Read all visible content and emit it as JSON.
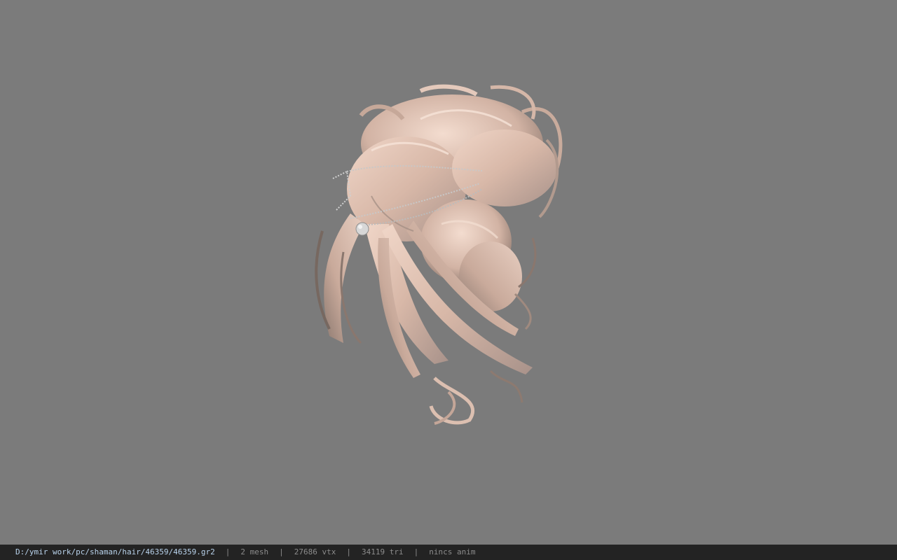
{
  "viewer": {
    "background": "#7b7b7b",
    "model_name": "hair-model",
    "hair_light_color": "#e6cbbd",
    "hair_dark_color": "#8f7a70",
    "accessory_color": "#c8c8c8"
  },
  "statusbar": {
    "file_path": "D:/ymir work/pc/shaman/hair/46359/46359.gr2",
    "separator": "|",
    "mesh_count": "2 mesh",
    "vertex_count": "27686 vtx",
    "triangle_count": "34119 tri",
    "anim_status": "nincs anim",
    "path_color": "#b9d3ec",
    "background": "#232323"
  }
}
